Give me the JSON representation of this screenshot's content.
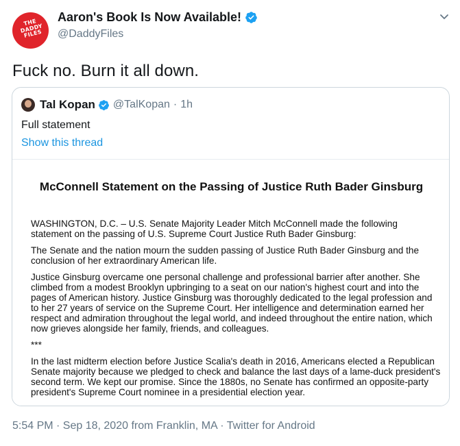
{
  "author": {
    "display_name": "Aaron's Book Is Now Available!",
    "handle": "@DaddyFiles",
    "avatar_text": [
      "THE",
      "DADDY",
      "FILES"
    ],
    "avatar_color": "#e0242b",
    "verified_icon": "verified-badge-icon"
  },
  "tweet": {
    "text": "Fuck no. Burn it all down.",
    "timestamp": "5:54 PM · Sep 18, 2020 from Franklin, MA · Twitter for Android"
  },
  "quoted_tweet": {
    "display_name": "Tal Kopan",
    "handle": "@TalKopan",
    "separator": "·",
    "time": "1h",
    "text": "Full statement",
    "link": "Show this thread",
    "link_color": "#1b95e0"
  },
  "statement": {
    "title": "McConnell Statement on the Passing of Justice Ruth Bader Ginsburg",
    "paragraphs": [
      "WASHINGTON, D.C. – U.S. Senate Majority Leader Mitch McConnell made the following statement on the passing of U.S. Supreme Court Justice Ruth Bader Ginsburg:",
      "The Senate and the nation mourn the sudden passing of Justice Ruth Bader Ginsburg and the conclusion of her extraordinary American life.",
      "Justice Ginsburg overcame one personal challenge and professional barrier after another. She climbed from a modest Brooklyn upbringing to a seat on our nation's highest court and into the pages of American history. Justice Ginsburg was thoroughly dedicated to the legal profession and to her 27 years of service on the Supreme Court. Her intelligence and determination earned her respect and admiration throughout the legal world, and indeed throughout the entire nation, which now grieves alongside her family, friends, and colleagues.",
      "***",
      "In the last midterm election before Justice Scalia's death in 2016, Americans elected a Republican Senate majority because we pledged to check and balance the last days of a lame-duck president's second term. We kept our promise. Since the 1880s, no Senate has confirmed an opposite-party president's Supreme Court nominee in a presidential election year."
    ]
  },
  "colors": {
    "text_primary": "#14171a",
    "text_secondary": "#657786",
    "verified_blue": "#1da1f2",
    "border": "#ccd6dd"
  }
}
